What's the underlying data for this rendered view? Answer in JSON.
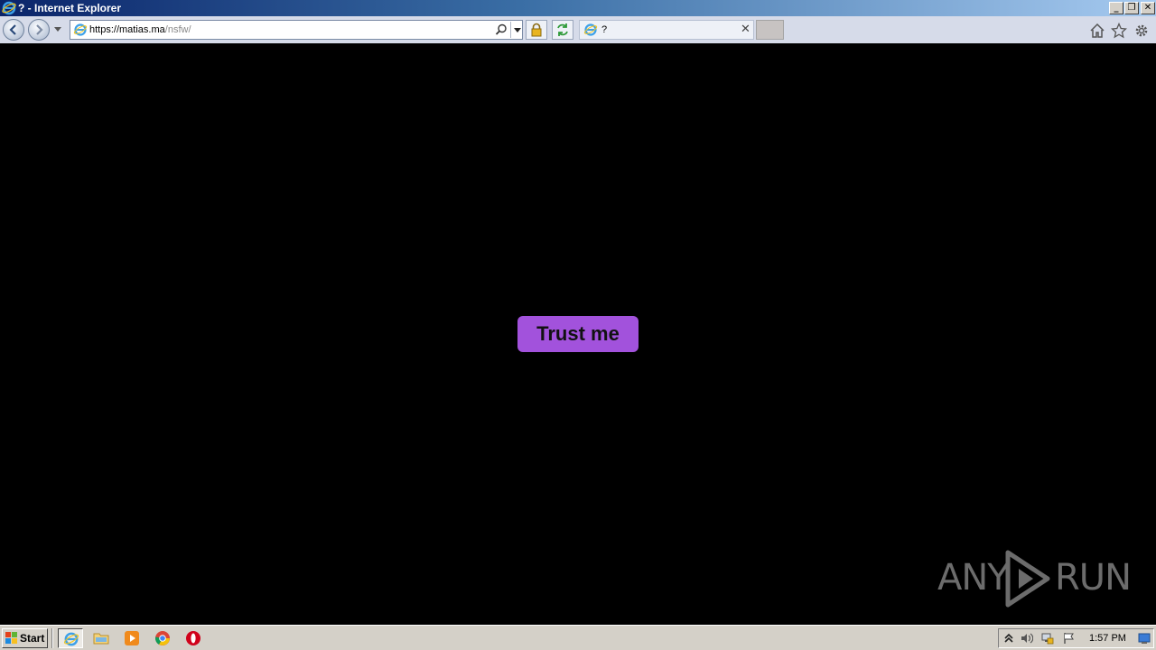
{
  "window": {
    "title": "? - Internet Explorer",
    "controls": {
      "minimize": "_",
      "restore": "❐",
      "close": "✕"
    }
  },
  "browser": {
    "address": {
      "domain": "https://matias.ma",
      "path": "/nsfw/"
    },
    "tab": {
      "title": "?"
    },
    "icons": [
      "back-icon",
      "forward-icon",
      "search-icon",
      "lock-icon",
      "refresh-icon",
      "home-icon",
      "favorites-star-icon",
      "settings-gear-icon"
    ]
  },
  "page": {
    "background": "#000000",
    "button": {
      "label": "Trust me",
      "color": "#a252dc"
    }
  },
  "watermark": {
    "text_left": "ANY",
    "text_right": "RUN"
  },
  "taskbar": {
    "start_label": "Start",
    "clock": "1:57 PM",
    "apps": [
      "internet-explorer-icon",
      "file-explorer-icon",
      "media-player-icon",
      "chrome-icon",
      "opera-icon"
    ]
  }
}
